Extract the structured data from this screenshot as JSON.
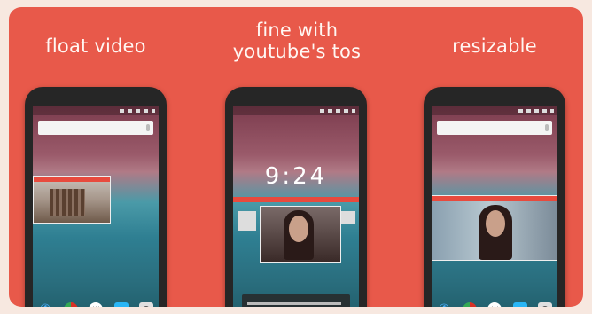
{
  "captions": {
    "left": "float video",
    "center_line1": "fine with",
    "center_line2": "youtube's tos",
    "right": "resizable"
  },
  "lockscreen": {
    "clock": "9:24"
  },
  "colors": {
    "banner": "#e8594a",
    "accent_bar": "#e84a3d"
  },
  "icons": {
    "dock": [
      "phone-icon",
      "chrome-icon",
      "app-launcher-icon",
      "messages-icon",
      "camera-icon"
    ]
  }
}
